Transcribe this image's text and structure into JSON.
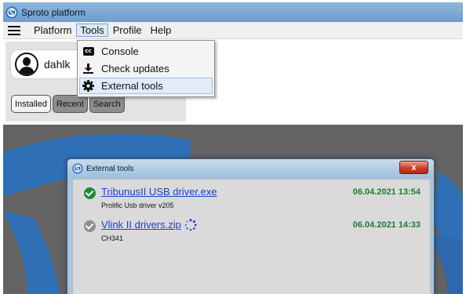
{
  "app": {
    "title": "Sproto platform",
    "brand_color": "#2f6fb6"
  },
  "menubar": {
    "items": [
      "Platform",
      "Tools",
      "Profile",
      "Help"
    ],
    "open_menu": "Tools"
  },
  "tools_menu": {
    "items": [
      {
        "label": "Console",
        "icon": "closed-captions-icon"
      },
      {
        "label": "Check updates",
        "icon": "download-icon"
      },
      {
        "label": "External tools",
        "icon": "gear-icon",
        "highlighted": true
      }
    ]
  },
  "sidebar": {
    "user_name": "dahlk",
    "tabs": [
      {
        "label": "Installed",
        "active": true
      },
      {
        "label": "Recent",
        "active": false
      },
      {
        "label": "Search",
        "active": false
      }
    ]
  },
  "dialog": {
    "title": "External tools",
    "close_label": "x",
    "files": [
      {
        "name": "TribunusII USB driver.exe",
        "description": "Prolific Usb driver v205",
        "date": "06.04.2021 13:54",
        "status": "downloaded",
        "status_icon": "check-circle-icon"
      },
      {
        "name": "Vlink II drivers.zip",
        "description": "CH341",
        "date": "06.04.2021 14:33",
        "status": "downloading",
        "status_icon": "check-circle-icon",
        "progress_icon": "loading-spinner-icon"
      }
    ]
  },
  "colors": {
    "link": "#1a3fcc",
    "date_green": "#1f7a36",
    "ok_green": "#1f8a3a",
    "close_red": "#c8402b"
  }
}
